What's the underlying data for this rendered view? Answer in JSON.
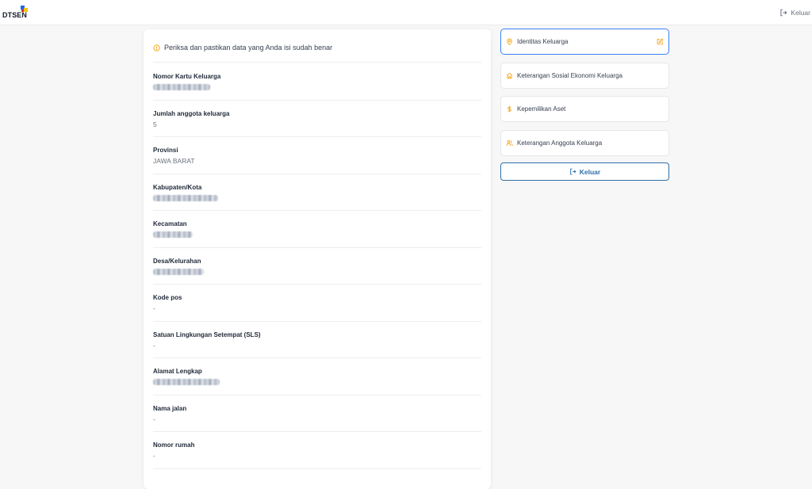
{
  "app": {
    "logo_text": "DTSEN",
    "logout_label": "Keluar",
    "colors": {
      "accent": "#2f6fa8",
      "active_border": "#3b82f6",
      "warning": "#f59e0b",
      "logo_blue": "#2563eb",
      "logo_yellow": "#f2c500",
      "logo_red": "#d32f2f"
    }
  },
  "form": {
    "notice": "Periksa dan pastikan data yang Anda isi sudah benar",
    "notice_icon": "info-circle-icon",
    "fields": [
      {
        "label": "Nomor Kartu Keluarga",
        "value": ""
      },
      {
        "label": "Jumlah anggota keluarga",
        "value": "5"
      },
      {
        "label": "Provinsi",
        "value": "JAWA BARAT"
      },
      {
        "label": "Kabupaten/Kota",
        "value": ""
      },
      {
        "label": "Kecamatan",
        "value": ""
      },
      {
        "label": "Desa/Kelurahan",
        "value": ""
      },
      {
        "label": "Kode pos",
        "value": "-"
      },
      {
        "label": "Satuan Lingkungan Setempat (SLS)",
        "value": "-"
      },
      {
        "label": "Alamat Lengkap",
        "value": ""
      },
      {
        "label": "Nama jalan",
        "value": "-"
      },
      {
        "label": "Nomor rumah",
        "value": "-"
      }
    ]
  },
  "sidebar": {
    "items": [
      {
        "label": "Identitas Keluarga",
        "icon": "map-pin-icon",
        "active": true
      },
      {
        "label": "Keterangan Sosial Ekonomi Keluarga",
        "icon": "home-icon",
        "active": false
      },
      {
        "label": "Kepemilikan Aset",
        "icon": "dollar-icon",
        "active": false
      },
      {
        "label": "Keterangan Anggota Keluarga",
        "icon": "users-icon",
        "active": false
      }
    ],
    "logout_label": "Keluar"
  }
}
